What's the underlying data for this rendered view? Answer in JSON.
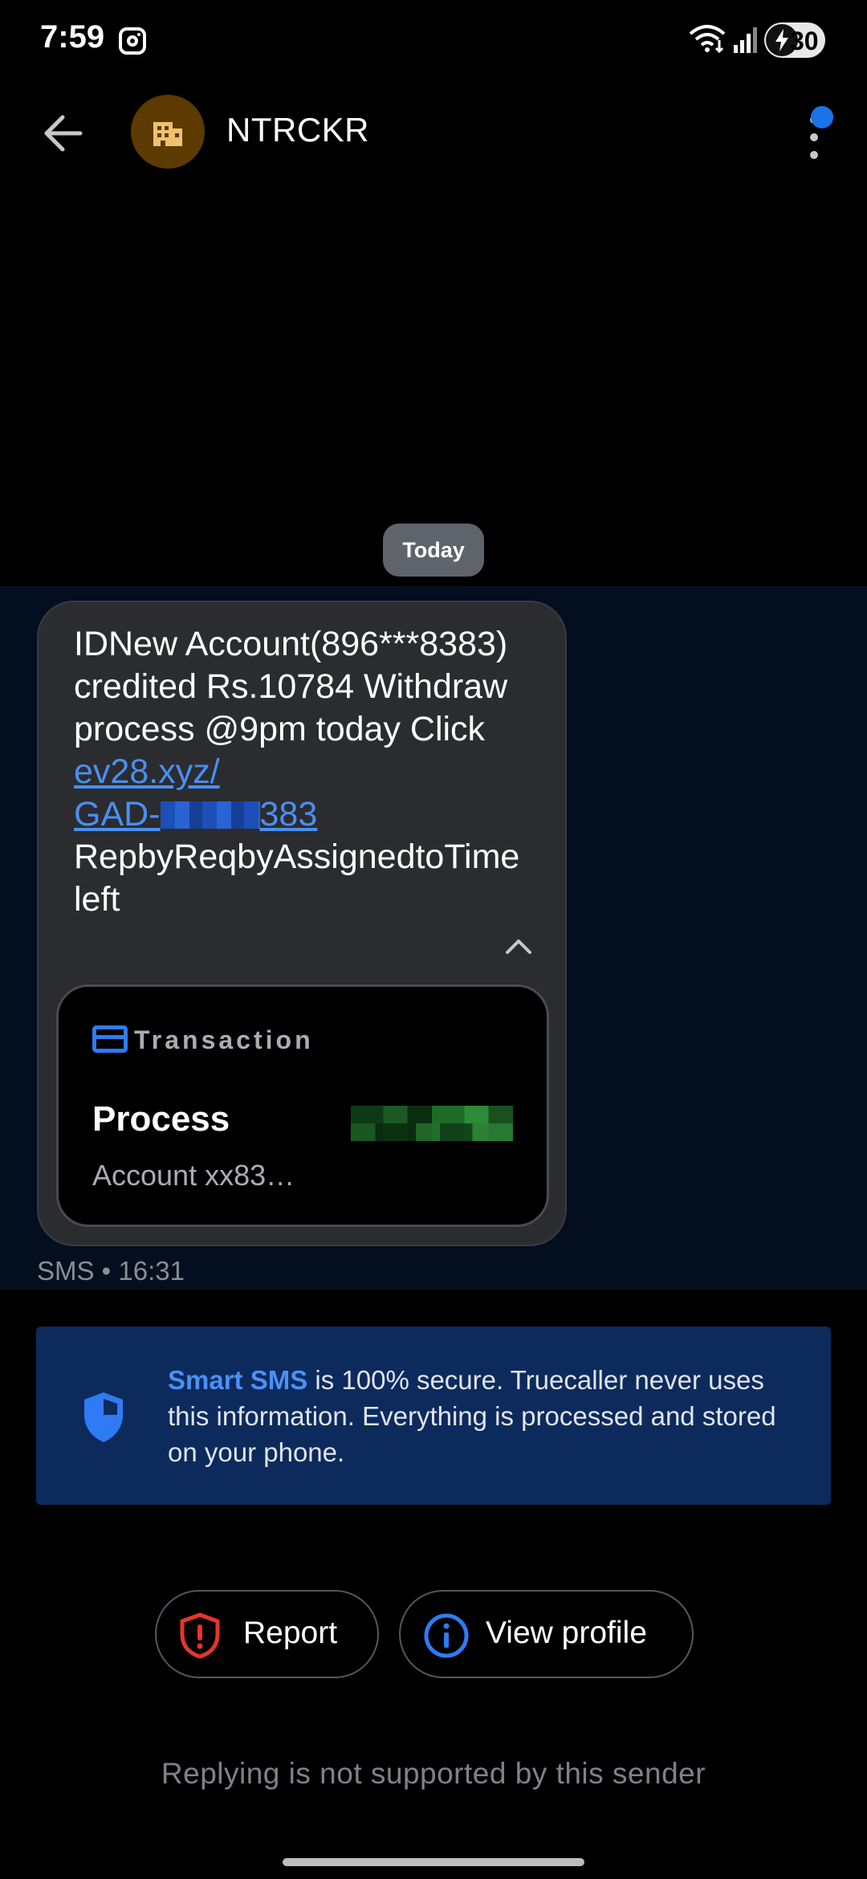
{
  "status_bar": {
    "time": "7:59",
    "battery_level": "30",
    "icons": [
      "instagram-icon",
      "wifi-icon",
      "signal-icon",
      "battery-charging-icon"
    ]
  },
  "header": {
    "sender_name": "NTRCKR",
    "avatar_icon": "building-icon",
    "avatar_color": "#5c3a00",
    "back_icon": "arrow-left-icon",
    "menu_icon": "more-vertical-icon",
    "notification_dot_color": "#1a73e8"
  },
  "date_chip": "Today",
  "message": {
    "text_before_link": "IDNew Account(896***8383) credited Rs.10784 Withdraw process @9pm today Click ",
    "link_part1": "ev28.xyz/",
    "link_part2_prefix": "GAD-",
    "link_part2_suffix": "383",
    "text_after_link": "RepbyReqbyAssignedtoTimeleft",
    "meta": "SMS • 16:31"
  },
  "transaction_card": {
    "label": "Transaction",
    "title": "Process",
    "subtitle": "Account xx83…"
  },
  "smart_sms": {
    "highlight": "Smart SMS",
    "text": " is 100% secure. Truecaller never uses this information. Everything is processed and stored on your phone."
  },
  "actions": {
    "report_label": "Report",
    "view_profile_label": "View profile"
  },
  "reply_note": "Replying is not supported by this sender",
  "colors": {
    "accent_blue": "#4a8ff0",
    "banner_bg": "#0d2a5c",
    "report_red": "#e5352b"
  }
}
